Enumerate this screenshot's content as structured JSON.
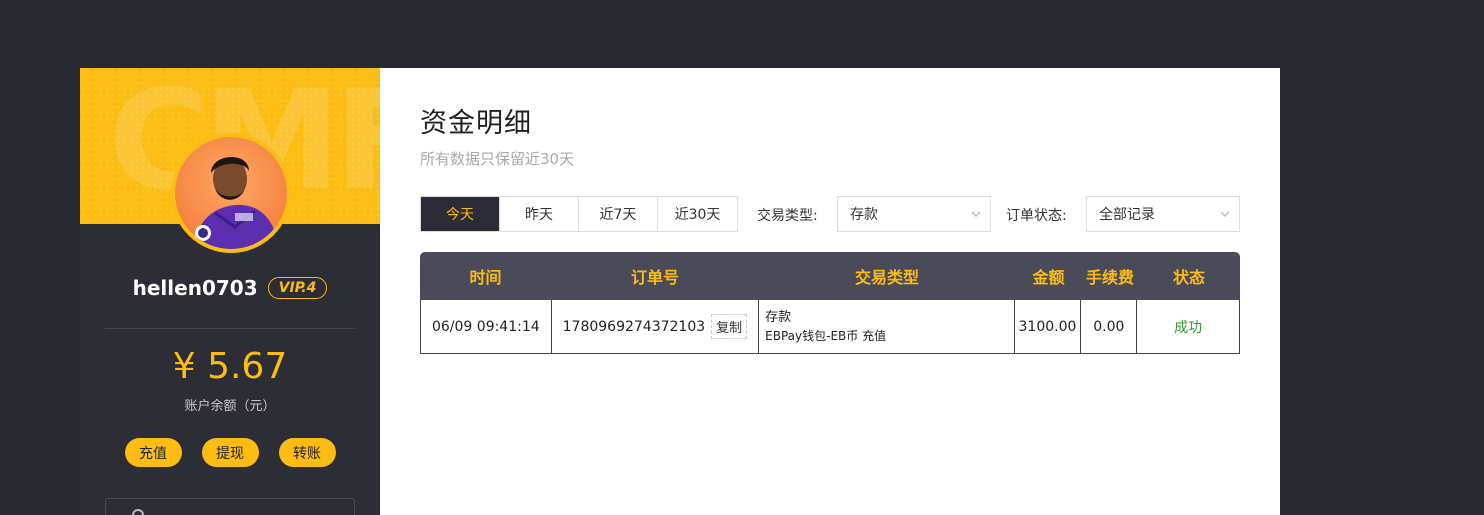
{
  "sidebar": {
    "banner_text": "CMF",
    "username": "hellen0703",
    "vip": "VIP.4",
    "balance": "¥ 5.67",
    "balance_label": "账户余额（元）",
    "actions": [
      "充值",
      "提现",
      "转账"
    ]
  },
  "main": {
    "title": "资金明细",
    "subtitle": "所有数据只保留近30天",
    "tabs": [
      "今天",
      "昨天",
      "近7天",
      "近30天"
    ],
    "active_tab": "今天",
    "filters": {
      "type_label": "交易类型:",
      "type_value": "存款",
      "status_label": "订单状态:",
      "status_value": "全部记录"
    },
    "table": {
      "headers": [
        "时间",
        "订单号",
        "交易类型",
        "金额",
        "手续费",
        "状态"
      ],
      "rows": [
        {
          "time": "06/09 09:41:14",
          "order_no": "1780969274372103",
          "copy_label": "复制",
          "type_main": "存款",
          "type_sub": "EBPay钱包-EB币 充值",
          "amount": "3100.00",
          "fee": "0.00",
          "status": "成功"
        }
      ]
    }
  },
  "colors": {
    "accent": "#fbbd14",
    "sidebar_bg": "#2c2d35",
    "table_header_bg": "#4a4a58",
    "success": "#2e9b2e"
  }
}
